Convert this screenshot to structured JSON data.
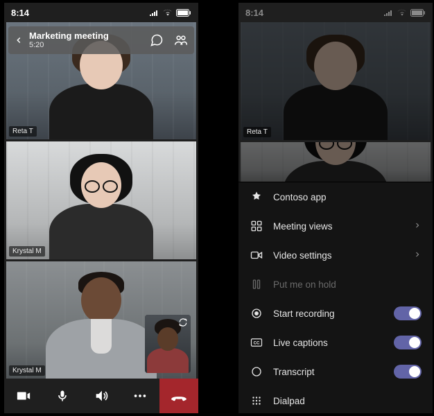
{
  "statusbar": {
    "time": "8:14"
  },
  "left": {
    "header": {
      "title": "Marketing meeting",
      "duration": "5:20"
    },
    "participants": [
      {
        "name": "Reta T"
      },
      {
        "name": "Krystal M"
      },
      {
        "name": "Krystal M"
      }
    ]
  },
  "right": {
    "participant_visible": "Reta T",
    "sheet": [
      {
        "icon": "app-icon",
        "label": "Contoso app",
        "type": "plain"
      },
      {
        "icon": "grid-icon",
        "label": "Meeting views",
        "type": "chevron"
      },
      {
        "icon": "video-icon",
        "label": "Video settings",
        "type": "chevron"
      },
      {
        "icon": "hold-icon",
        "label": "Put me on hold",
        "type": "muted"
      },
      {
        "icon": "record-icon",
        "label": "Start recording",
        "type": "toggle"
      },
      {
        "icon": "cc-icon",
        "label": "Live captions",
        "type": "toggle"
      },
      {
        "icon": "transcript-icon",
        "label": "Transcript",
        "type": "toggle"
      },
      {
        "icon": "dialpad-icon",
        "label": "Dialpad",
        "type": "plain"
      }
    ]
  }
}
